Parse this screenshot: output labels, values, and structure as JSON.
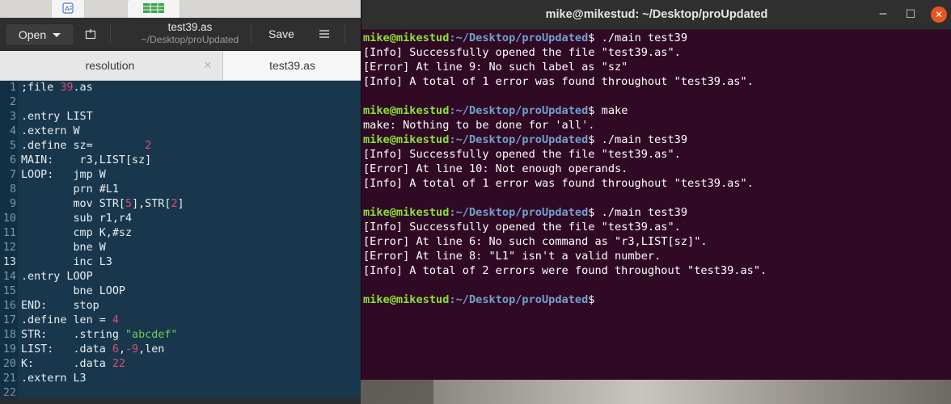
{
  "gedit": {
    "open_label": "Open",
    "save_label": "Save",
    "title": "test39.as",
    "subtitle": "~/Desktop/proUpdated",
    "tabs": [
      {
        "label": "resolution"
      },
      {
        "label": "test39.as"
      }
    ],
    "current_line": 13,
    "lines": [
      {
        "n": "1",
        "segs": [
          {
            "t": ";file ",
            "c": ""
          },
          {
            "t": "39",
            "c": "nm"
          },
          {
            "t": ".as",
            "c": ""
          }
        ]
      },
      {
        "n": "2",
        "segs": []
      },
      {
        "n": "3",
        "segs": [
          {
            "t": ".entry LIST",
            "c": ""
          }
        ]
      },
      {
        "n": "4",
        "segs": [
          {
            "t": ".extern W",
            "c": ""
          }
        ]
      },
      {
        "n": "5",
        "segs": [
          {
            "t": ".define sz=        ",
            "c": ""
          },
          {
            "t": "2",
            "c": "nm"
          }
        ]
      },
      {
        "n": "6",
        "segs": [
          {
            "t": "MAIN:    r3,LIST[sz]",
            "c": ""
          }
        ]
      },
      {
        "n": "7",
        "segs": [
          {
            "t": "LOOP:   jmp W",
            "c": ""
          }
        ]
      },
      {
        "n": "8",
        "segs": [
          {
            "t": "        prn #L1",
            "c": ""
          }
        ]
      },
      {
        "n": "9",
        "segs": [
          {
            "t": "        mov STR[",
            "c": ""
          },
          {
            "t": "5",
            "c": "nm"
          },
          {
            "t": "],STR[",
            "c": ""
          },
          {
            "t": "2",
            "c": "nm"
          },
          {
            "t": "]",
            "c": ""
          }
        ]
      },
      {
        "n": "10",
        "segs": [
          {
            "t": "        sub r1,r4",
            "c": ""
          }
        ]
      },
      {
        "n": "11",
        "segs": [
          {
            "t": "        cmp K,#sz",
            "c": ""
          }
        ]
      },
      {
        "n": "12",
        "segs": [
          {
            "t": "        bne W",
            "c": ""
          }
        ]
      },
      {
        "n": "13",
        "segs": [
          {
            "t": "        inc L3",
            "c": ""
          }
        ]
      },
      {
        "n": "14",
        "segs": [
          {
            "t": ".entry LOOP",
            "c": ""
          }
        ]
      },
      {
        "n": "15",
        "segs": [
          {
            "t": "        bne LOOP",
            "c": ""
          }
        ]
      },
      {
        "n": "16",
        "segs": [
          {
            "t": "END:    stop",
            "c": ""
          }
        ]
      },
      {
        "n": "17",
        "segs": [
          {
            "t": ".define len = ",
            "c": ""
          },
          {
            "t": "4",
            "c": "nm"
          }
        ]
      },
      {
        "n": "18",
        "segs": [
          {
            "t": "STR:    .string ",
            "c": ""
          },
          {
            "t": "\"abcdef\"",
            "c": "st"
          }
        ]
      },
      {
        "n": "19",
        "segs": [
          {
            "t": "LIST:   .data ",
            "c": ""
          },
          {
            "t": "6",
            "c": "nm"
          },
          {
            "t": ",",
            "c": ""
          },
          {
            "t": "-9",
            "c": "nm"
          },
          {
            "t": ",len",
            "c": ""
          }
        ]
      },
      {
        "n": "20",
        "segs": [
          {
            "t": "K:      .data ",
            "c": ""
          },
          {
            "t": "22",
            "c": "nm"
          }
        ]
      },
      {
        "n": "21",
        "segs": [
          {
            "t": ".extern L3",
            "c": ""
          }
        ]
      },
      {
        "n": "22",
        "segs": []
      }
    ]
  },
  "terminal": {
    "title": "mike@mikestud: ~/Desktop/proUpdated",
    "user": "mike@mikestud",
    "path": ":~/Desktop/proUpdated",
    "lines": [
      {
        "prompt": true,
        "cmd": " ./main test39"
      },
      {
        "text": "[Info] Successfully opened the file \"test39.as\"."
      },
      {
        "text": "[Error] At line 9: No such label as \"sz\""
      },
      {
        "text": "[Info] A total of 1 error was found throughout \"test39.as\"."
      },
      {
        "text": ""
      },
      {
        "prompt": true,
        "cmd": " make"
      },
      {
        "text": "make: Nothing to be done for 'all'."
      },
      {
        "prompt": true,
        "cmd": " ./main test39"
      },
      {
        "text": "[Info] Successfully opened the file \"test39.as\"."
      },
      {
        "text": "[Error] At line 10: Not enough operands."
      },
      {
        "text": "[Info] A total of 1 error was found throughout \"test39.as\"."
      },
      {
        "text": ""
      },
      {
        "prompt": true,
        "cmd": " ./main test39"
      },
      {
        "text": "[Info] Successfully opened the file \"test39.as\"."
      },
      {
        "text": "[Error] At line 6: No such command as \"r3,LIST[sz]\"."
      },
      {
        "text": "[Error] At line 8: \"L1\" isn't a valid number."
      },
      {
        "text": "[Info] A total of 2 errors were found throughout \"test39.as\"."
      },
      {
        "text": ""
      },
      {
        "prompt": true,
        "cmd": " "
      }
    ]
  },
  "colors": {
    "terminal_bg": "#300a24",
    "prompt_user": "#8ae234",
    "prompt_path": "#729fcf",
    "editor_bg": "#18374c",
    "number": "#e24a78",
    "string": "#6ccd5b",
    "close_button": "#e95420"
  },
  "icons": [
    "dictionary-icon",
    "spreadsheet-icon",
    "new-tab-icon",
    "hamburger-menu-icon",
    "tab-close-icon",
    "minimize-icon",
    "maximize-icon",
    "close-icon"
  ]
}
